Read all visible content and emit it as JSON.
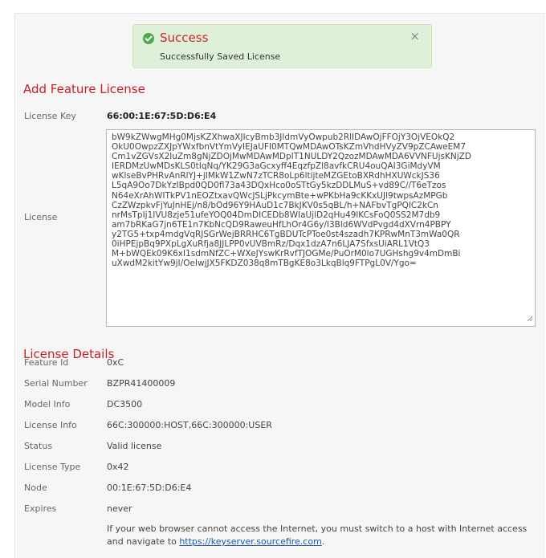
{
  "alert": {
    "title": "Success",
    "message": "Successfully Saved License",
    "close_glyph": "×",
    "icon": "check-circle-icon",
    "color": "#4fa84f"
  },
  "add_feature": {
    "heading": "Add Feature License",
    "license_key_label": "License Key",
    "license_key_value": "66:00:1E:67:5D:D6:E4",
    "license_label": "License",
    "license_lines": [
      "bW9kZWwgMHg0MjsKZXhwaXJlcyBmb3JldmVyOwpub2RlIDAwOjFFOjY3OjVEOkQ2",
      "OkU0OwpzZXJpYWxfbnVtYmVyIEJaUFI0MTQwMDAwOTsKZmVhdHVyZV9pZCAweEM7",
      "Cm1vZGVsX2luZm8gNjZDOjMwMDAwMDpIT1NULDY2QzozMDAwMDA6VVNFUjsKNjZD",
      "IERDMzUwMDsKLS0tIqNq/YK29G3aGcxyff4EqzfpZl8avfkCRU4ouQAI3GiMdyVM",
      "wKlseBvPHRvAnRlYJ+jIMkW1ZwN7zTCR8oLp6ltijteMZGEtoBXRdhHXUWckJS36",
      "L5qA9Oo7DkYzIBpd0QD0fl73a43DQxHco0oSTtGy5kzDDLMuS+vd89C//T6eTzos",
      "N64eXrAhWITkPV1nEOZtxavQWcJSLjPkcymBte+wPKbHa9cKKxUJl9twpsAzMPGb",
      "CzZWzpkvFjYuJnHEj/n8/bOd96Y9HAuD1c7BkJKV0s5qBL/h+NAFbvTgPQlC2kCn",
      "nrMsTpIj1IVU8zje51ufeYOQ04DmDICEDb8WIaUjlD2qHu49lKCsFoQ0SS2M7db9",
      "am7bRKaG7jn6TE1n7KbNcQD9RaweuHfLhOr4G6y/I3Bld6WVdPvgd4dXVrn4PBPY",
      "y2TG5+txp4mdgVqRJSGrWejBRRHC6TgBDUTcPToe0st4szadh7KPRwMnT3mWa0QR",
      "0iHPEjpBq9PXpLgXuRfja8JJLPP0vUVBmRz/Dqx1dzA7n6LJA7SfxsUiARL1VtQ3",
      "M+bWQEk09K6xI1sdmNfZC+WXeJYswKrRvfTJOGMe/PuOrM0lo7UGHshg9v4mDmBi",
      "uXwdM2kitYw9jI/OeIwjJX5FKDZ038q8mTBgKE8o3LkqBlq9FTPgL0V/Ygo="
    ]
  },
  "details": {
    "heading": "License Details",
    "rows": [
      {
        "label": "Feature Id",
        "value": "0xC"
      },
      {
        "label": "Serial Number",
        "value": "BZPR41400009"
      },
      {
        "label": "Model Info",
        "value": "DC3500"
      },
      {
        "label": "License Info",
        "value": "66C:300000:HOST,66C:300000:USER"
      },
      {
        "label": "Status",
        "value": "Valid license"
      },
      {
        "label": "License Type",
        "value": "0x42"
      },
      {
        "label": "Node",
        "value": "00:1E:67:5D:D6:E4"
      },
      {
        "label": "Expires",
        "value": "never"
      }
    ]
  },
  "note": {
    "text_before": "If your web browser cannot access the Internet, you must switch to a host with Internet access and navigate to ",
    "link_text": "https://keyserver.sourcefire.com",
    "text_after": "."
  },
  "colors": {
    "heading_red": "#c8202a",
    "alert_bg": "#dff0d8",
    "link_blue": "#1a5da8"
  }
}
